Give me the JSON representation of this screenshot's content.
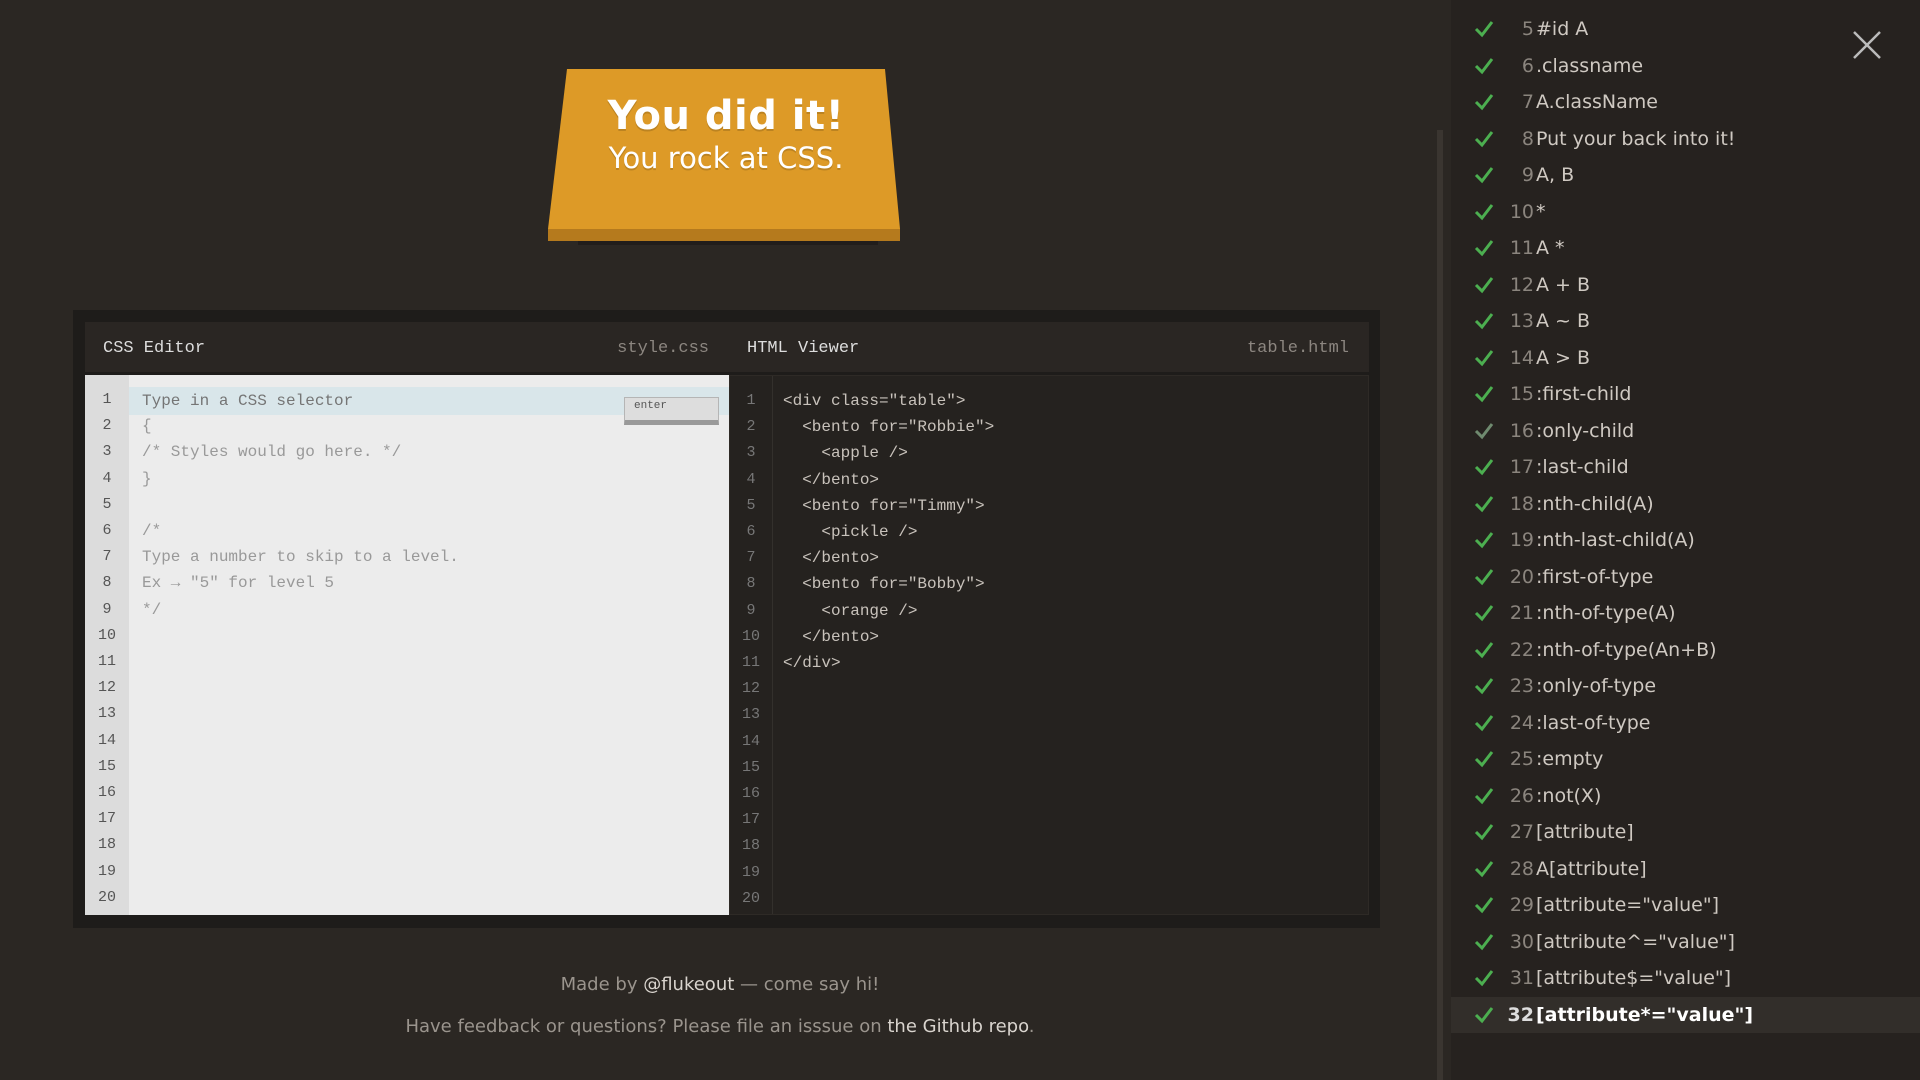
{
  "banner": {
    "title": "You did it!",
    "subtitle": "You rock at CSS."
  },
  "css_editor": {
    "title": "CSS Editor",
    "file": "style.css",
    "input_placeholder": "Type in a CSS selector",
    "enter_label": "enter",
    "line_numbers": [
      "1",
      "2",
      "3",
      "4",
      "5",
      "6",
      "7",
      "8",
      "9",
      "10",
      "11",
      "12",
      "13",
      "14",
      "15",
      "16",
      "17",
      "18",
      "19",
      "20"
    ],
    "code_lines": [
      "{",
      "/* Styles would go here. */",
      "}",
      "",
      "/*",
      "Type a number to skip to a level.",
      "Ex → \"5\" for level 5",
      "*/"
    ]
  },
  "html_viewer": {
    "title": "HTML Viewer",
    "file": "table.html",
    "line_numbers": [
      "1",
      "2",
      "3",
      "4",
      "5",
      "6",
      "7",
      "8",
      "9",
      "10",
      "11",
      "12",
      "13",
      "14",
      "15",
      "16",
      "17",
      "18",
      "19",
      "20"
    ],
    "code_lines": [
      "<div class=\"table\">",
      "  <bento for=\"Robbie\">",
      "    <apple />",
      "  </bento>",
      "  <bento for=\"Timmy\">",
      "    <pickle />",
      "  </bento>",
      "  <bento for=\"Bobby\">",
      "    <orange />",
      "  </bento>",
      "</div>"
    ]
  },
  "footer": {
    "made_by_prefix": "Made by ",
    "made_by_link": "@flukeout",
    "made_by_suffix": " — come say hi!",
    "feedback_prefix": "Have feedback or questions? Please file an isssue on ",
    "feedback_link": "the Github repo",
    "feedback_suffix": "."
  },
  "sidebar": {
    "levels": [
      {
        "num": "5",
        "name": "#id  A",
        "done": true
      },
      {
        "num": "6",
        "name": ".classname",
        "done": true
      },
      {
        "num": "7",
        "name": "A.className",
        "done": true
      },
      {
        "num": "8",
        "name": "Put your back into it!",
        "done": true
      },
      {
        "num": "9",
        "name": "A, B",
        "done": true
      },
      {
        "num": "10",
        "name": "*",
        "done": true
      },
      {
        "num": "11",
        "name": "A  *",
        "done": true
      },
      {
        "num": "12",
        "name": "A + B",
        "done": true
      },
      {
        "num": "13",
        "name": "A ~ B",
        "done": true
      },
      {
        "num": "14",
        "name": "A > B",
        "done": true
      },
      {
        "num": "15",
        "name": ":first-child",
        "done": true
      },
      {
        "num": "16",
        "name": ":only-child",
        "done": false
      },
      {
        "num": "17",
        "name": ":last-child",
        "done": true
      },
      {
        "num": "18",
        "name": ":nth-child(A)",
        "done": true
      },
      {
        "num": "19",
        "name": ":nth-last-child(A)",
        "done": true
      },
      {
        "num": "20",
        "name": ":first-of-type",
        "done": true
      },
      {
        "num": "21",
        "name": ":nth-of-type(A)",
        "done": true
      },
      {
        "num": "22",
        "name": ":nth-of-type(An+B)",
        "done": true
      },
      {
        "num": "23",
        "name": ":only-of-type",
        "done": true
      },
      {
        "num": "24",
        "name": ":last-of-type",
        "done": true
      },
      {
        "num": "25",
        "name": ":empty",
        "done": true
      },
      {
        "num": "26",
        "name": ":not(X)",
        "done": true
      },
      {
        "num": "27",
        "name": "[attribute]",
        "done": true
      },
      {
        "num": "28",
        "name": "A[attribute]",
        "done": true
      },
      {
        "num": "29",
        "name": "[attribute=\"value\"]",
        "done": true
      },
      {
        "num": "30",
        "name": "[attribute^=\"value\"]",
        "done": true
      },
      {
        "num": "31",
        "name": "[attribute$=\"value\"]",
        "done": true
      },
      {
        "num": "32",
        "name": "[attribute*=\"value\"]",
        "done": true,
        "active": true
      }
    ]
  },
  "colors": {
    "check_done": "#4caf50",
    "check_pending": "#6f8a6f",
    "banner": "#dd9a27"
  }
}
